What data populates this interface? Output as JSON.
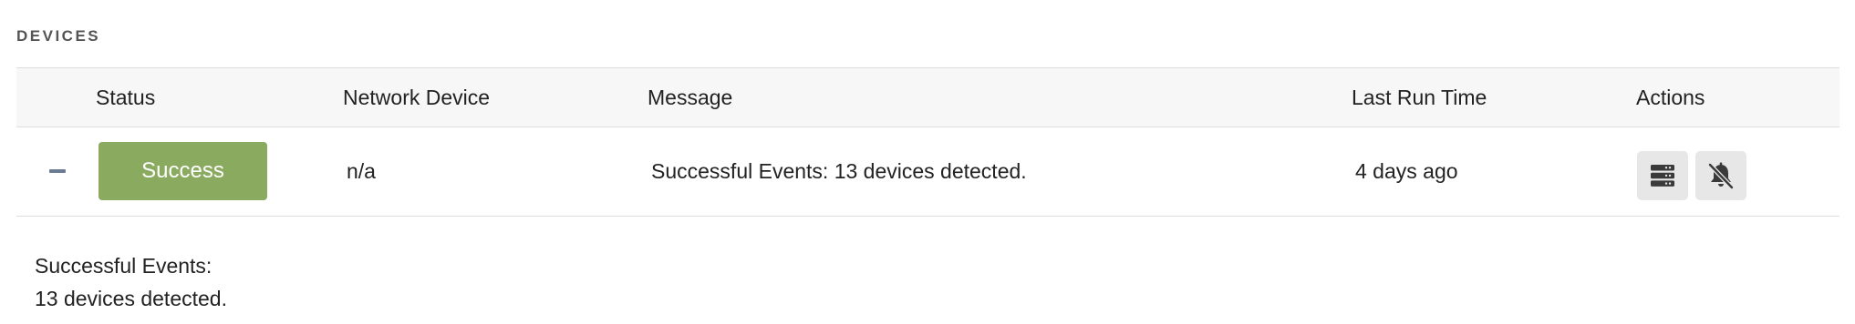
{
  "section": {
    "title": "DEVICES"
  },
  "table": {
    "headers": {
      "status": "Status",
      "network_device": "Network Device",
      "message": "Message",
      "last_run_time": "Last Run Time",
      "actions": "Actions"
    },
    "rows": [
      {
        "status": "Success",
        "network_device": "n/a",
        "message": "Successful Events: 13 devices detected.",
        "last_run_time": "4 days ago"
      }
    ]
  },
  "detail": {
    "line1": "Successful Events:",
    "line2": "13 devices detected."
  },
  "icons": {
    "collapse": "minus-icon",
    "action_1": "server-stack-icon",
    "action_2": "bell-slash-icon"
  },
  "colors": {
    "success": "#8aab5f",
    "header_bg": "#f7f7f7",
    "action_bg": "#e7e7e7"
  }
}
